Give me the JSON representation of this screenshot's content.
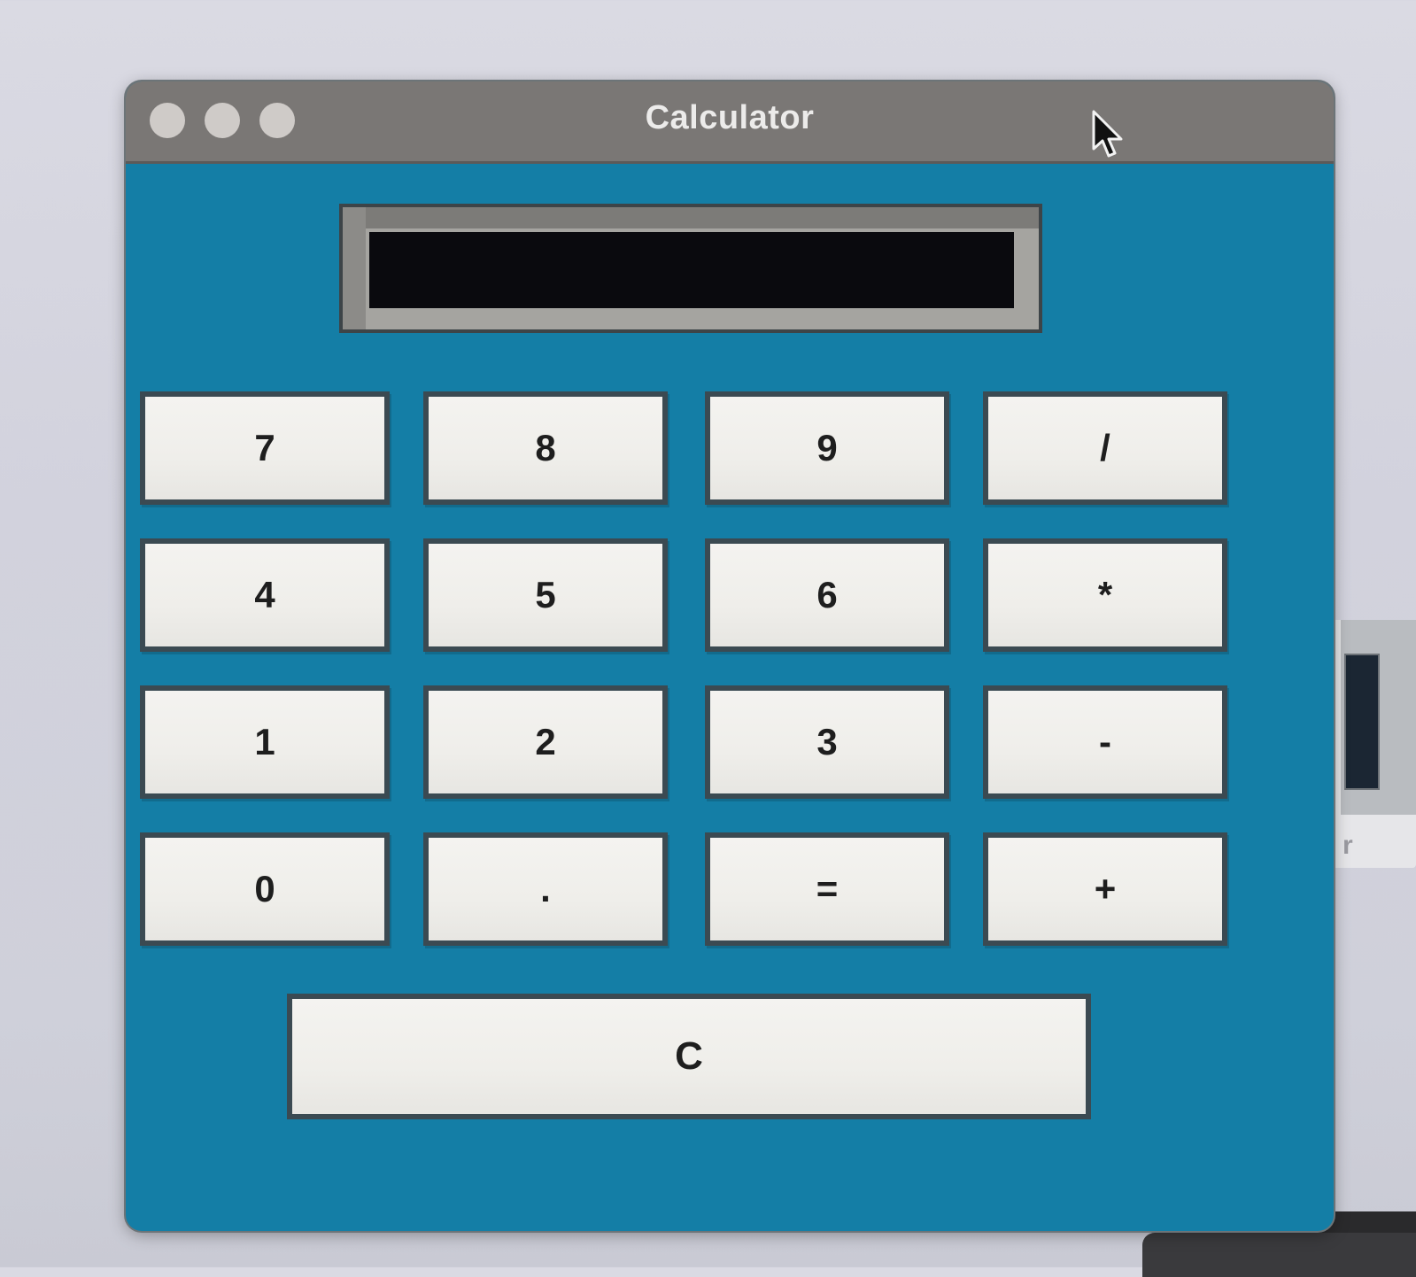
{
  "window": {
    "title": "Calculator"
  },
  "display": {
    "value": ""
  },
  "keys": [
    {
      "label": "7",
      "name": "key-7"
    },
    {
      "label": "8",
      "name": "key-8"
    },
    {
      "label": "9",
      "name": "key-9"
    },
    {
      "label": "/",
      "name": "key-divide"
    },
    {
      "label": "4",
      "name": "key-4"
    },
    {
      "label": "5",
      "name": "key-5"
    },
    {
      "label": "6",
      "name": "key-6"
    },
    {
      "label": "*",
      "name": "key-multiply"
    },
    {
      "label": "1",
      "name": "key-1"
    },
    {
      "label": "2",
      "name": "key-2"
    },
    {
      "label": "3",
      "name": "key-3"
    },
    {
      "label": "-",
      "name": "key-subtract"
    },
    {
      "label": "0",
      "name": "key-0"
    },
    {
      "label": ".",
      "name": "key-decimal"
    },
    {
      "label": "=",
      "name": "key-equals"
    },
    {
      "label": "+",
      "name": "key-add"
    }
  ],
  "clear": {
    "label": "C"
  },
  "background_fragment": {
    "text": "r"
  },
  "colors": {
    "window_background": "#147ea6",
    "titlebar": "#7a7775",
    "display_screen": "#0a0a0e",
    "key_face": "#f4f3f0",
    "key_border": "#3b4a52"
  }
}
